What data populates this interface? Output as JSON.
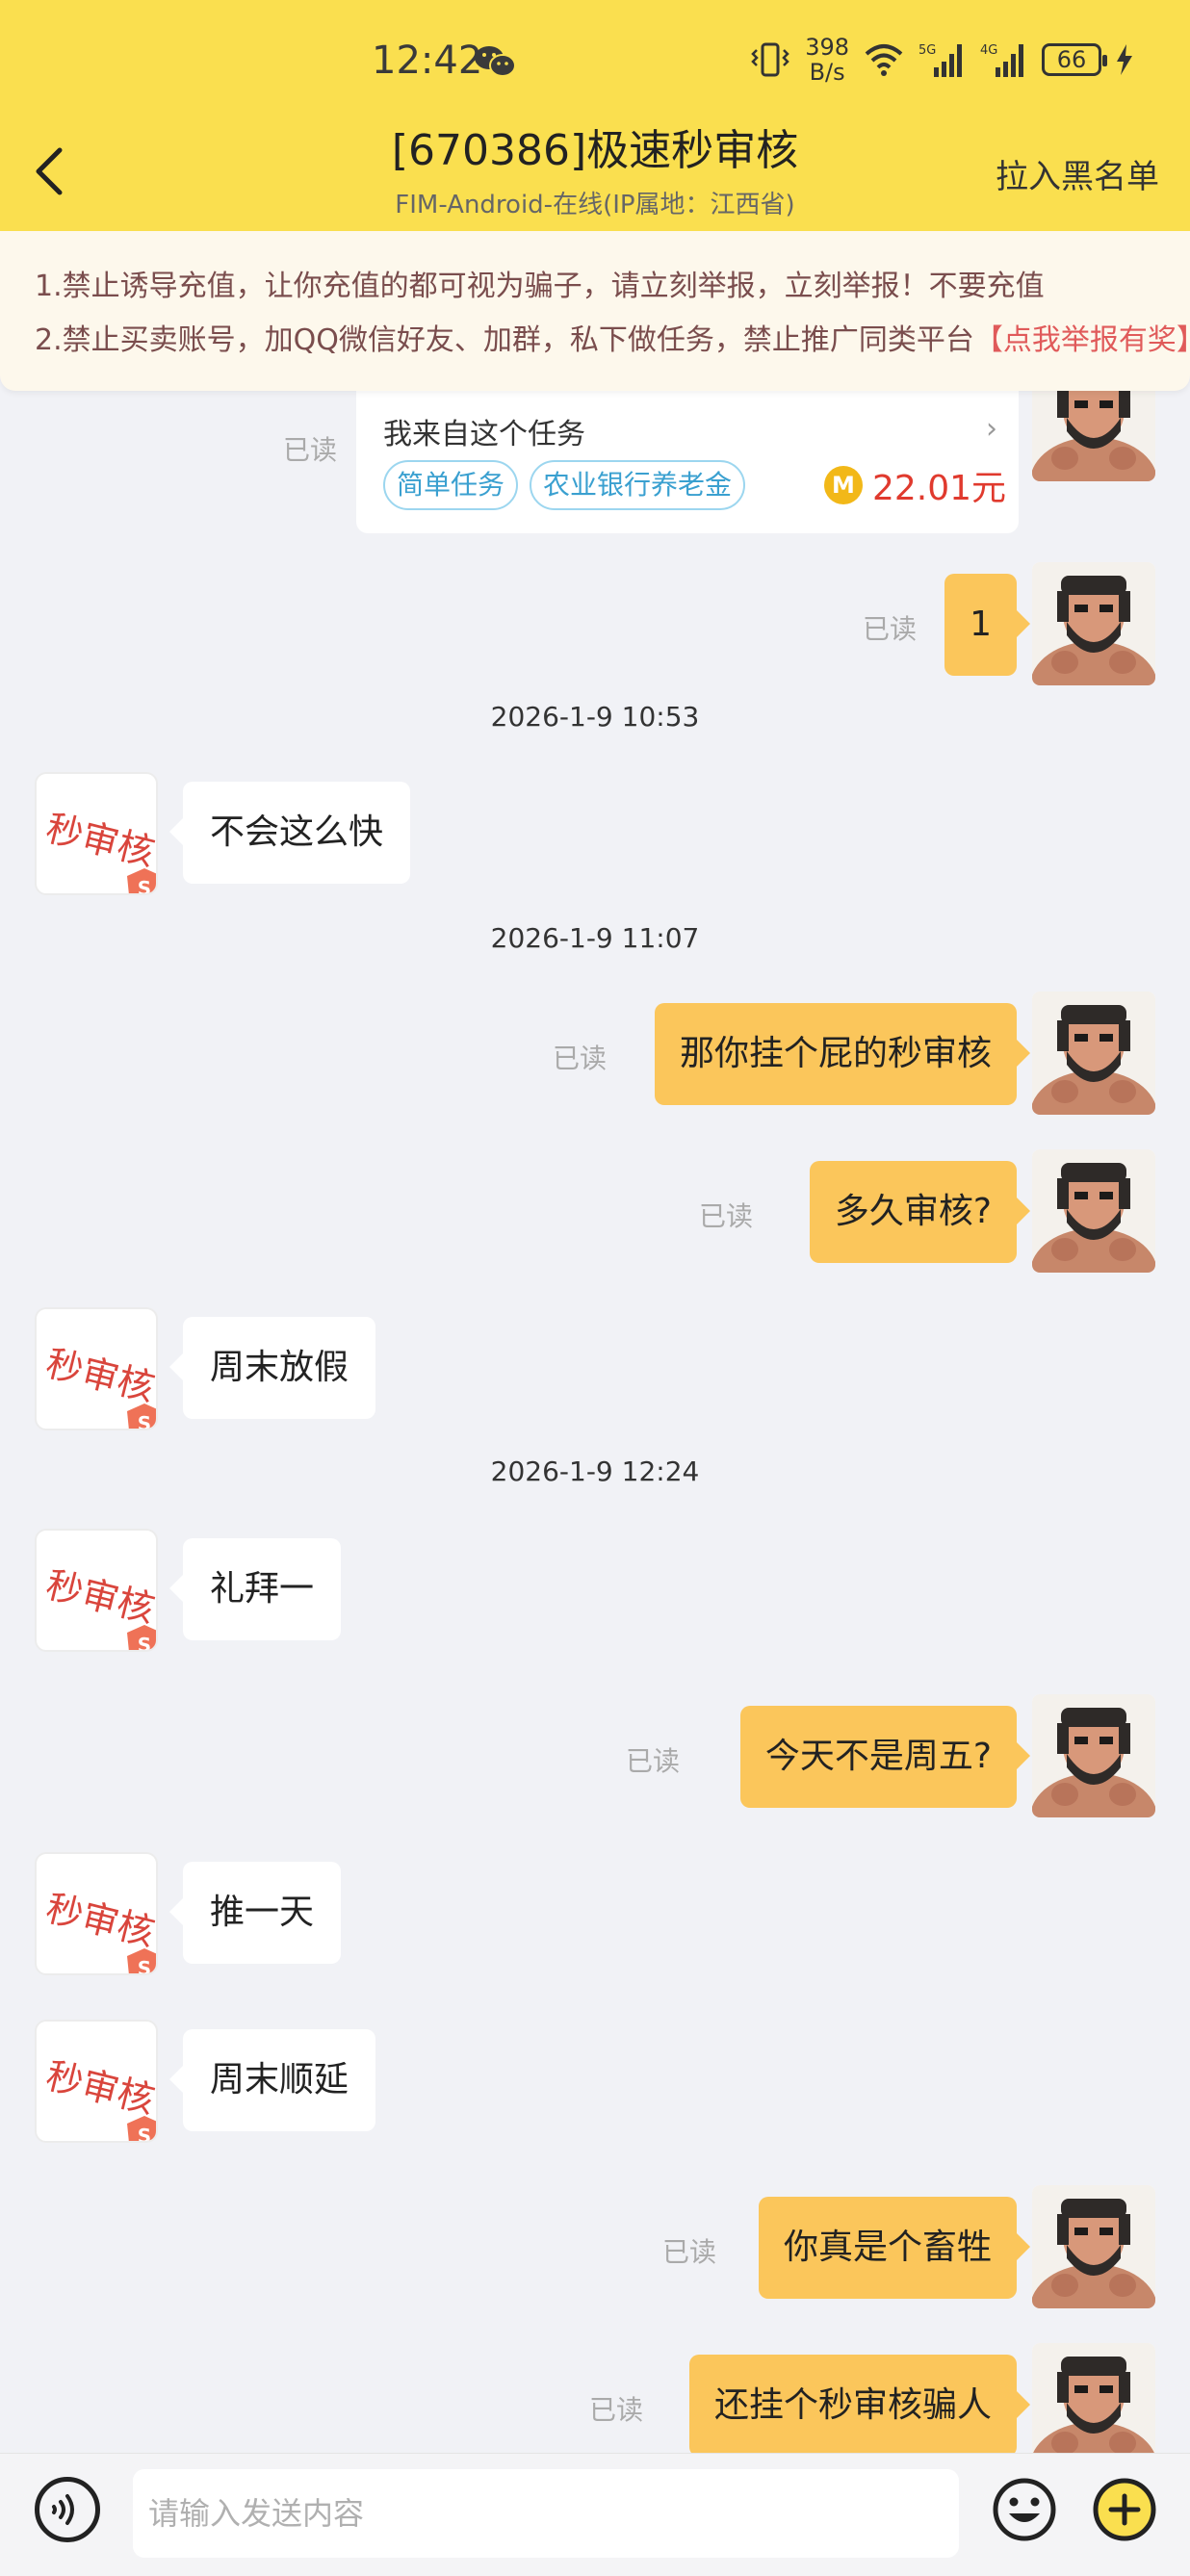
{
  "status_bar": {
    "time": "12:42",
    "speed_value": "398",
    "speed_unit": "B/s",
    "net1": "5G",
    "net2": "4G",
    "battery": "66"
  },
  "header": {
    "title": "[670386]极速秒审核",
    "subtitle": "FIM-Android-在线(IP属地：江西省)",
    "blacklist_label": "拉入黑名单",
    "back_icon": "chevron-left-icon"
  },
  "notice": {
    "line1": "1.禁止诱导充值，让你充值的都可视为骗子，请立刻举报，立刻举报！不要充值",
    "line2": "2.禁止买卖账号，加QQ微信好友、加群，私下做任务，禁止推广同类平台",
    "report_link": "【点我举报有奖】"
  },
  "task_card": {
    "title": "我来自这个任务",
    "tags": [
      "简单任务",
      "农业银行养老金"
    ],
    "coin_symbol": "M",
    "reward": "22.01元"
  },
  "read_label": "已读",
  "bot_avatar_text": "秒审核",
  "bot_badge_text": "S",
  "messages": [
    {
      "id": "m1",
      "side": "right",
      "text": "1",
      "read": "已读"
    },
    {
      "id": "t1",
      "type": "timestamp",
      "text": "2026-1-9 10:53"
    },
    {
      "id": "m2",
      "side": "left",
      "text": "不会这么快"
    },
    {
      "id": "t2",
      "type": "timestamp",
      "text": "2026-1-9 11:07"
    },
    {
      "id": "m3",
      "side": "right",
      "text": "那你挂个屁的秒审核",
      "read": "已读"
    },
    {
      "id": "m4",
      "side": "right",
      "text": "多久审核?",
      "read": "已读"
    },
    {
      "id": "m5",
      "side": "left",
      "text": "周末放假"
    },
    {
      "id": "t3",
      "type": "timestamp",
      "text": "2026-1-9 12:24"
    },
    {
      "id": "m6",
      "side": "left",
      "text": "礼拜一"
    },
    {
      "id": "m7",
      "side": "right",
      "text": "今天不是周五?",
      "read": "已读"
    },
    {
      "id": "m8",
      "side": "left",
      "text": "推一天"
    },
    {
      "id": "m9",
      "side": "left",
      "text": "周末顺延"
    },
    {
      "id": "m10",
      "side": "right",
      "text": "你真是个畜牲",
      "read": "已读"
    },
    {
      "id": "m11",
      "side": "right",
      "text": "还挂个秒审核骗人",
      "read": "已读"
    }
  ],
  "input": {
    "placeholder": "请输入发送内容",
    "value": ""
  },
  "icons": {
    "voice": "voice-icon",
    "emoji": "emoji-icon",
    "plus": "plus-icon"
  },
  "colors": {
    "header_bg": "#fadf4f",
    "bubble_right": "#fbc65b",
    "report": "#e05a5a",
    "reward": "#e03a2e",
    "tag": "#3aa0d0"
  }
}
